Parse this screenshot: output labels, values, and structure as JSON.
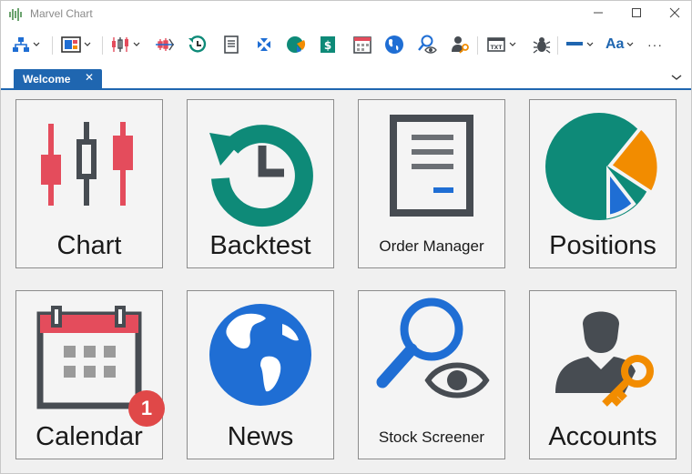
{
  "window": {
    "title": "Marvel Chart",
    "app_icon": "signal-icon"
  },
  "window_controls": [
    "minimize-icon",
    "maximize-icon",
    "close-icon"
  ],
  "toolbar": {
    "items": [
      "hierarchy-icon",
      "layout-icon",
      "candlestick-icon",
      "indicator-icon",
      "history-icon",
      "document-icon",
      "collapse-icon",
      "pie-icon",
      "dollar-icon",
      "calendar-icon",
      "globe-icon",
      "search-eye-icon",
      "user-key-icon",
      "text-file-icon",
      "bug-icon",
      "line-style-icon",
      "font-icon",
      "more-icon"
    ],
    "font_label": "Aa",
    "more_label": "···"
  },
  "tabs": [
    {
      "label": "Welcome",
      "close": "✕",
      "active": true
    }
  ],
  "tiles": [
    {
      "label": "Chart",
      "icon": "candlestick-icon"
    },
    {
      "label": "Backtest",
      "icon": "history-icon"
    },
    {
      "label": "Order Manager",
      "icon": "document-icon"
    },
    {
      "label": "Positions",
      "icon": "pie-icon"
    },
    {
      "label": "Calendar",
      "icon": "calendar-icon",
      "badge": "1"
    },
    {
      "label": "News",
      "icon": "globe-icon"
    },
    {
      "label": "Stock Screener",
      "icon": "search-eye-icon"
    },
    {
      "label": "Accounts",
      "icon": "user-key-icon"
    }
  ],
  "colors": {
    "accent": "#1f66b0",
    "red": "#e44c5c",
    "dark": "#474c52",
    "teal": "#0e8a78",
    "orange": "#f28c00",
    "blue": "#1f6ed4",
    "badge": "#e04848"
  }
}
